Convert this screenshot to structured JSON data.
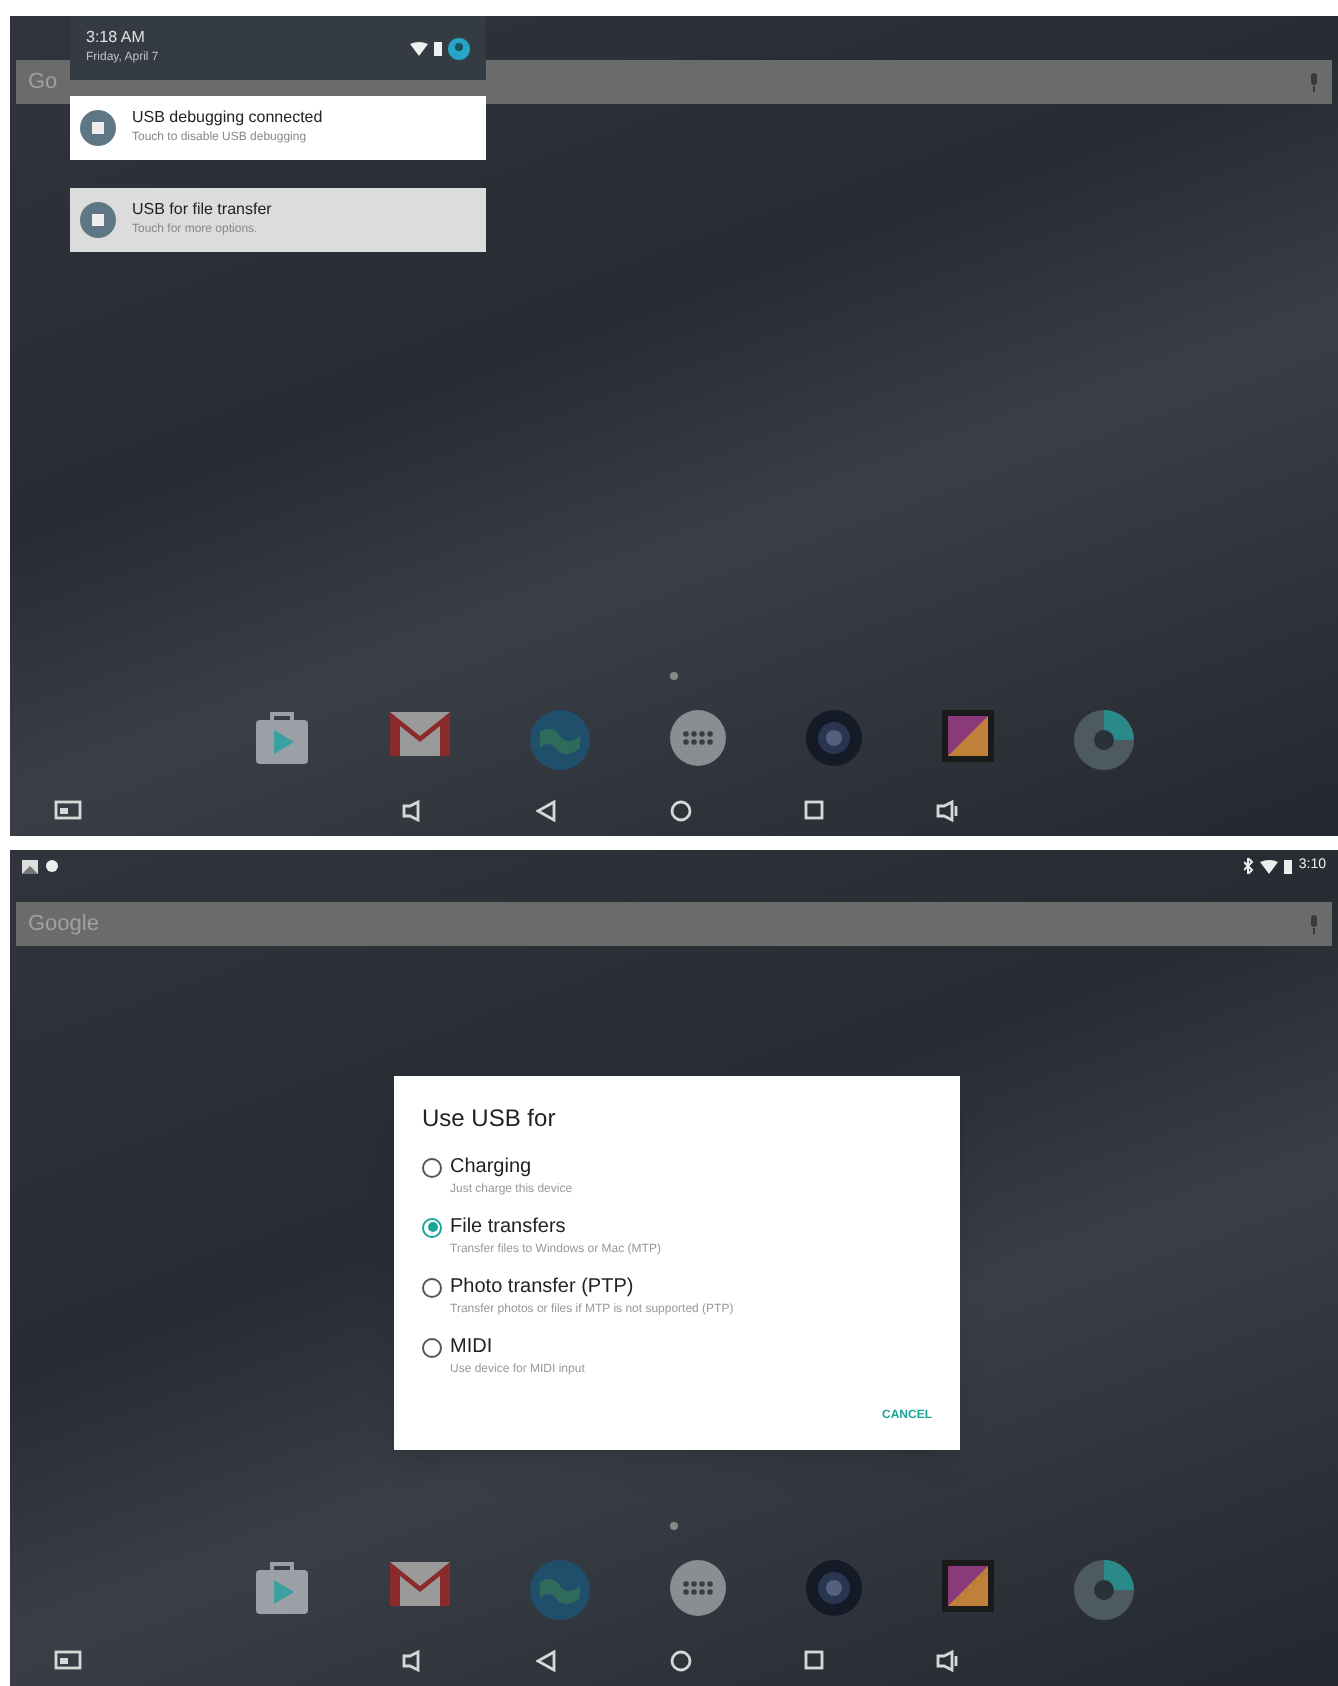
{
  "screens": [
    {
      "kind": "shade",
      "search": {
        "label": "Go"
      },
      "shade": {
        "time": "3:18 AM",
        "date": "Friday, April 7",
        "notifications": [
          {
            "title": "USB debugging connected",
            "text": "Touch to disable USB debugging",
            "selected": false
          },
          {
            "title": "USB for file transfer",
            "text": "Touch for more options.",
            "selected": true
          }
        ]
      }
    },
    {
      "kind": "dialog",
      "status_bar": {
        "time": "3:10"
      },
      "search": {
        "label": "Google"
      },
      "dialog": {
        "title": "Use USB for",
        "options": [
          {
            "label": "Charging",
            "text": "Just charge this device",
            "selected": false
          },
          {
            "label": "File transfers",
            "text": "Transfer files to Windows or Mac (MTP)",
            "selected": true
          },
          {
            "label": "Photo transfer (PTP)",
            "text": "Transfer photos or files if MTP is not supported (PTP)",
            "selected": false
          },
          {
            "label": "MIDI",
            "text": "Use device for MIDI input",
            "selected": false
          }
        ],
        "button": "CANCEL"
      }
    }
  ]
}
